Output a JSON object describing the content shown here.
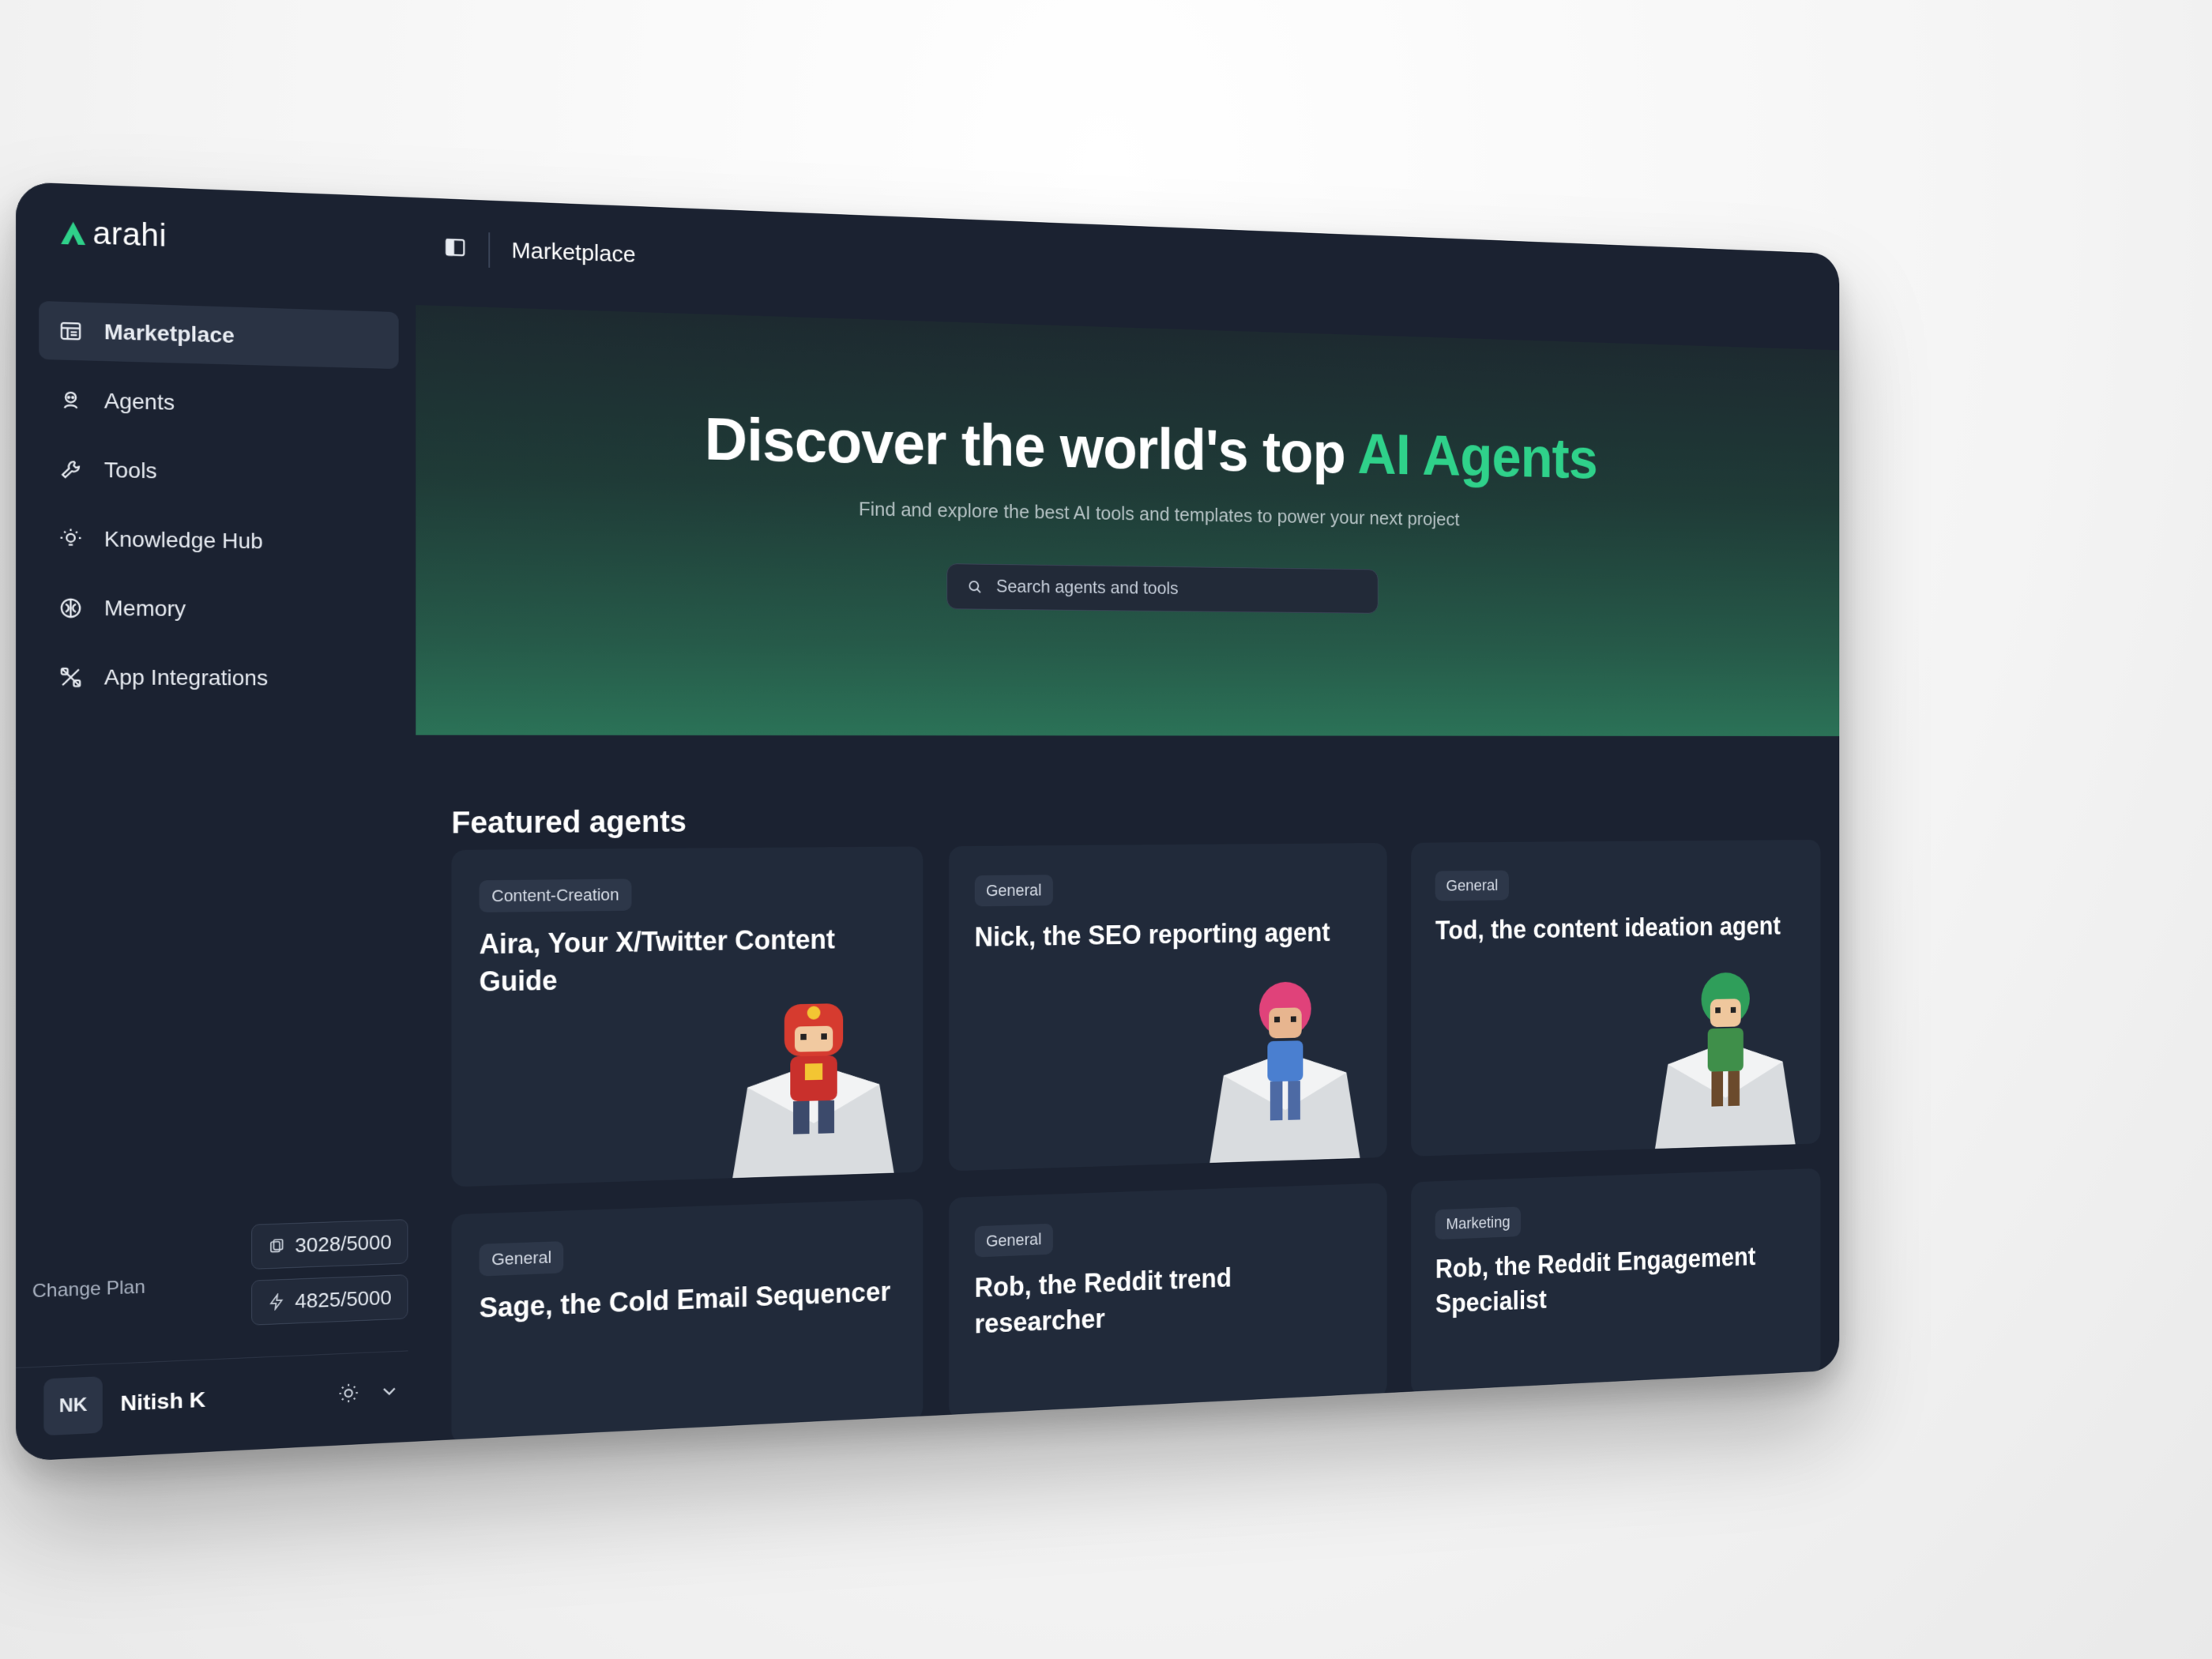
{
  "app": {
    "brand": "arahi",
    "accent": "#2fd18a"
  },
  "sidebar": {
    "items": [
      {
        "label": "Marketplace",
        "icon": "layout-icon",
        "active": true
      },
      {
        "label": "Agents",
        "icon": "agent-icon",
        "active": false
      },
      {
        "label": "Tools",
        "icon": "wrench-icon",
        "active": false
      },
      {
        "label": "Knowledge Hub",
        "icon": "lightbulb-icon",
        "active": false
      },
      {
        "label": "Memory",
        "icon": "brain-icon",
        "active": false
      },
      {
        "label": "App Integrations",
        "icon": "integrations-icon",
        "active": false
      }
    ],
    "change_plan": "Change Plan",
    "usage": [
      {
        "value": "3028/5000",
        "icon": "credits-icon"
      },
      {
        "value": "4825/5000",
        "icon": "bolt-icon"
      }
    ],
    "user": {
      "initials": "NK",
      "name": "Nitish K"
    }
  },
  "topbar": {
    "title": "Marketplace"
  },
  "hero": {
    "title_prefix": "Discover the world's top ",
    "title_accent": "AI Agents",
    "subtitle": "Find and explore the best AI tools and templates to power your next project",
    "search_placeholder": "Search agents and tools"
  },
  "featured": {
    "title": "Featured agents",
    "cards": [
      {
        "category": "Content-Creation",
        "title": "Aira, Your X/Twitter Content Guide",
        "character": "red-armored-hero"
      },
      {
        "category": "General",
        "title": "Nick, the SEO reporting agent",
        "character": "pink-haired-character"
      },
      {
        "category": "General",
        "title": "Tod, the content ideation agent",
        "character": "green-haired-character"
      },
      {
        "category": "General",
        "title": "Sage, the Cold Email Sequencer",
        "character": ""
      },
      {
        "category": "General",
        "title": "Rob, the Reddit trend researcher",
        "character": ""
      },
      {
        "category": "Marketing",
        "title": "Rob, the Reddit Engagement Specialist",
        "character": ""
      }
    ]
  }
}
